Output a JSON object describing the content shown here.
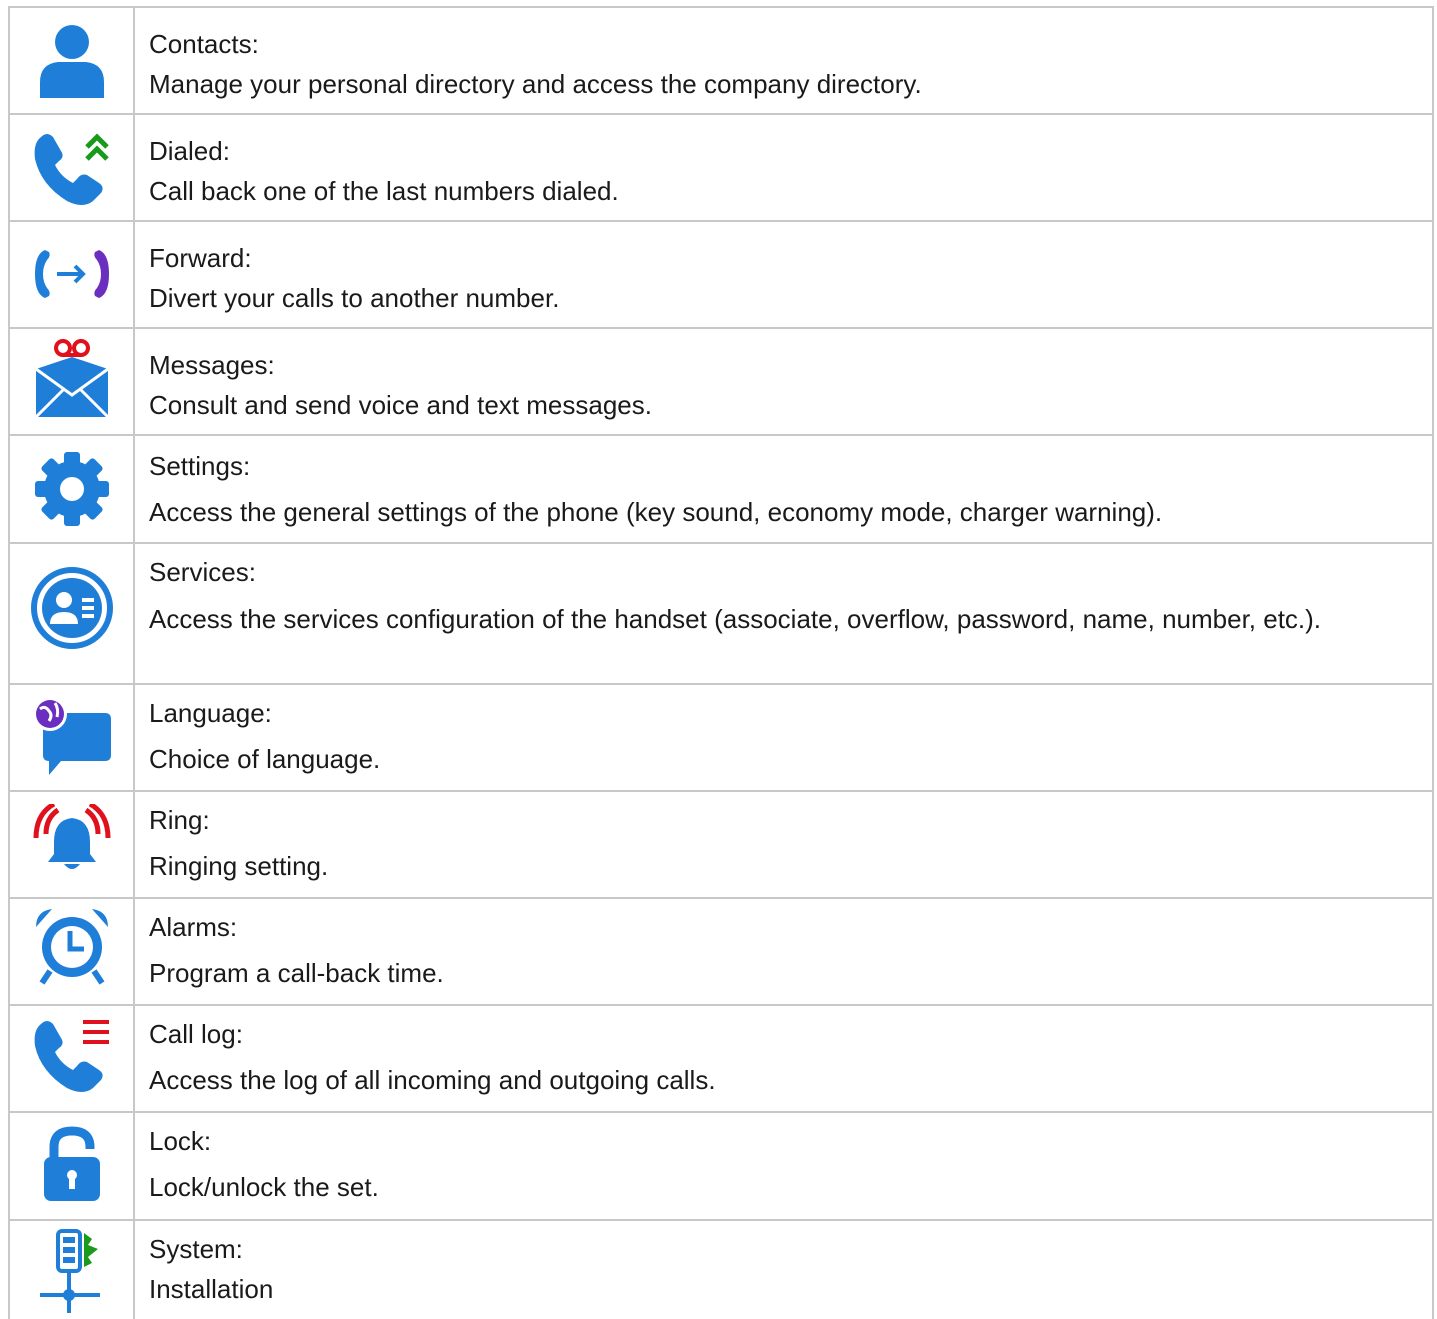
{
  "colors": {
    "blue": "#1f7fd8",
    "green": "#1a9a1a",
    "red": "#e0101c",
    "purple": "#6a2fbf",
    "border": "#c8c8c8"
  },
  "rows": [
    {
      "icon": "contacts-icon",
      "title": "Contacts:",
      "desc": "Manage your personal directory and access the company directory."
    },
    {
      "icon": "dialed-icon",
      "title": "Dialed:",
      "desc": "Call back one of the last numbers dialed."
    },
    {
      "icon": "forward-icon",
      "title": "Forward:",
      "desc": "Divert your calls to another number."
    },
    {
      "icon": "messages-icon",
      "title": "Messages:",
      "desc": "Consult and send voice and text messages."
    },
    {
      "icon": "settings-icon",
      "title": "Settings:",
      "desc": "Access the general settings of the phone (key sound, economy mode, charger warning)."
    },
    {
      "icon": "services-icon",
      "title": "Services:",
      "desc": "Access the services configuration of the handset (associate, overflow, password, name, number, etc.)."
    },
    {
      "icon": "language-icon",
      "title": "Language:",
      "desc": "Choice of language."
    },
    {
      "icon": "ring-icon",
      "title": "Ring:",
      "desc": "Ringing setting."
    },
    {
      "icon": "alarms-icon",
      "title": "Alarms:",
      "desc": "Program a call-back time."
    },
    {
      "icon": "call-log-icon",
      "title": "Call log:",
      "desc": "Access the log of all incoming and outgoing calls."
    },
    {
      "icon": "lock-icon",
      "title": "Lock:",
      "desc": "Lock/unlock the set."
    },
    {
      "icon": "system-icon",
      "title": "System:",
      "desc": "Installation"
    }
  ]
}
